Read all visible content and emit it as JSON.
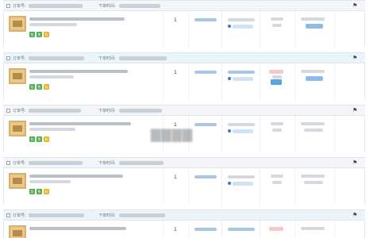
{
  "orders": [
    {
      "order_label": "订单号:",
      "time_label": "下单时间:",
      "quantity": "1",
      "alt": false,
      "tags": [
        "包",
        "免",
        "标"
      ]
    },
    {
      "order_label": "订单号:",
      "time_label": "下单时间:",
      "quantity": "1",
      "alt": true,
      "tags": [
        "包",
        "免",
        "标"
      ]
    },
    {
      "order_label": "订单号:",
      "time_label": "下单时间:",
      "quantity": "1",
      "alt": false,
      "tags": [
        "包",
        "免",
        "标"
      ]
    },
    {
      "order_label": "订单号:",
      "time_label": "下单时间:",
      "quantity": "1",
      "alt": false,
      "tags": [
        "包",
        "免",
        "标"
      ]
    },
    {
      "order_label": "订单号:",
      "time_label": "下单时间:",
      "quantity": "1",
      "alt": true,
      "tags": [
        "包",
        "免",
        "标"
      ]
    }
  ],
  "flag_icon": "flag-icon",
  "colors": {
    "header_bg": "#f3f5f8",
    "header_alt_bg": "#eaf5fb",
    "tag_green": "#4caf50",
    "tag_yellow": "#e6b422",
    "accent_blue": "#2f80d1"
  }
}
